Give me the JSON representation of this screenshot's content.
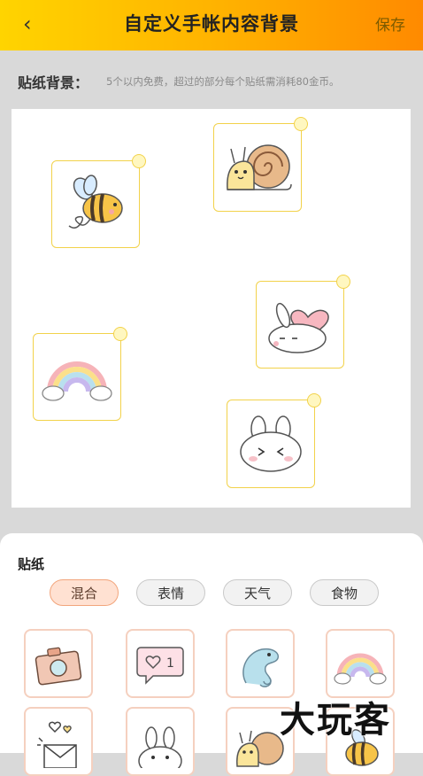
{
  "header": {
    "back_icon": "‹",
    "title": "自定义手帐内容背景",
    "save_label": "保存"
  },
  "background": {
    "label": "贴纸背景：",
    "note": "5个以内免费，超过的部分每个贴纸需消耗80金币。"
  },
  "stickers_on_canvas": [
    "bee-sticker",
    "snail-sticker",
    "bunny-heart-sticker",
    "rainbow-sticker",
    "bunny-face-sticker"
  ],
  "sheet": {
    "title": "贴纸",
    "categories": [
      "混合",
      "表情",
      "天气",
      "食物"
    ],
    "active_category": "混合"
  },
  "grid_items": [
    "camera-icon",
    "heart-bubble-icon",
    "chameleon-icon",
    "rainbow-icon",
    "envelope-heart-icon",
    "bunny-icon",
    "snail-icon",
    "bee-icon"
  ],
  "heart_bubble_count": "1",
  "watermark": "大玩客"
}
